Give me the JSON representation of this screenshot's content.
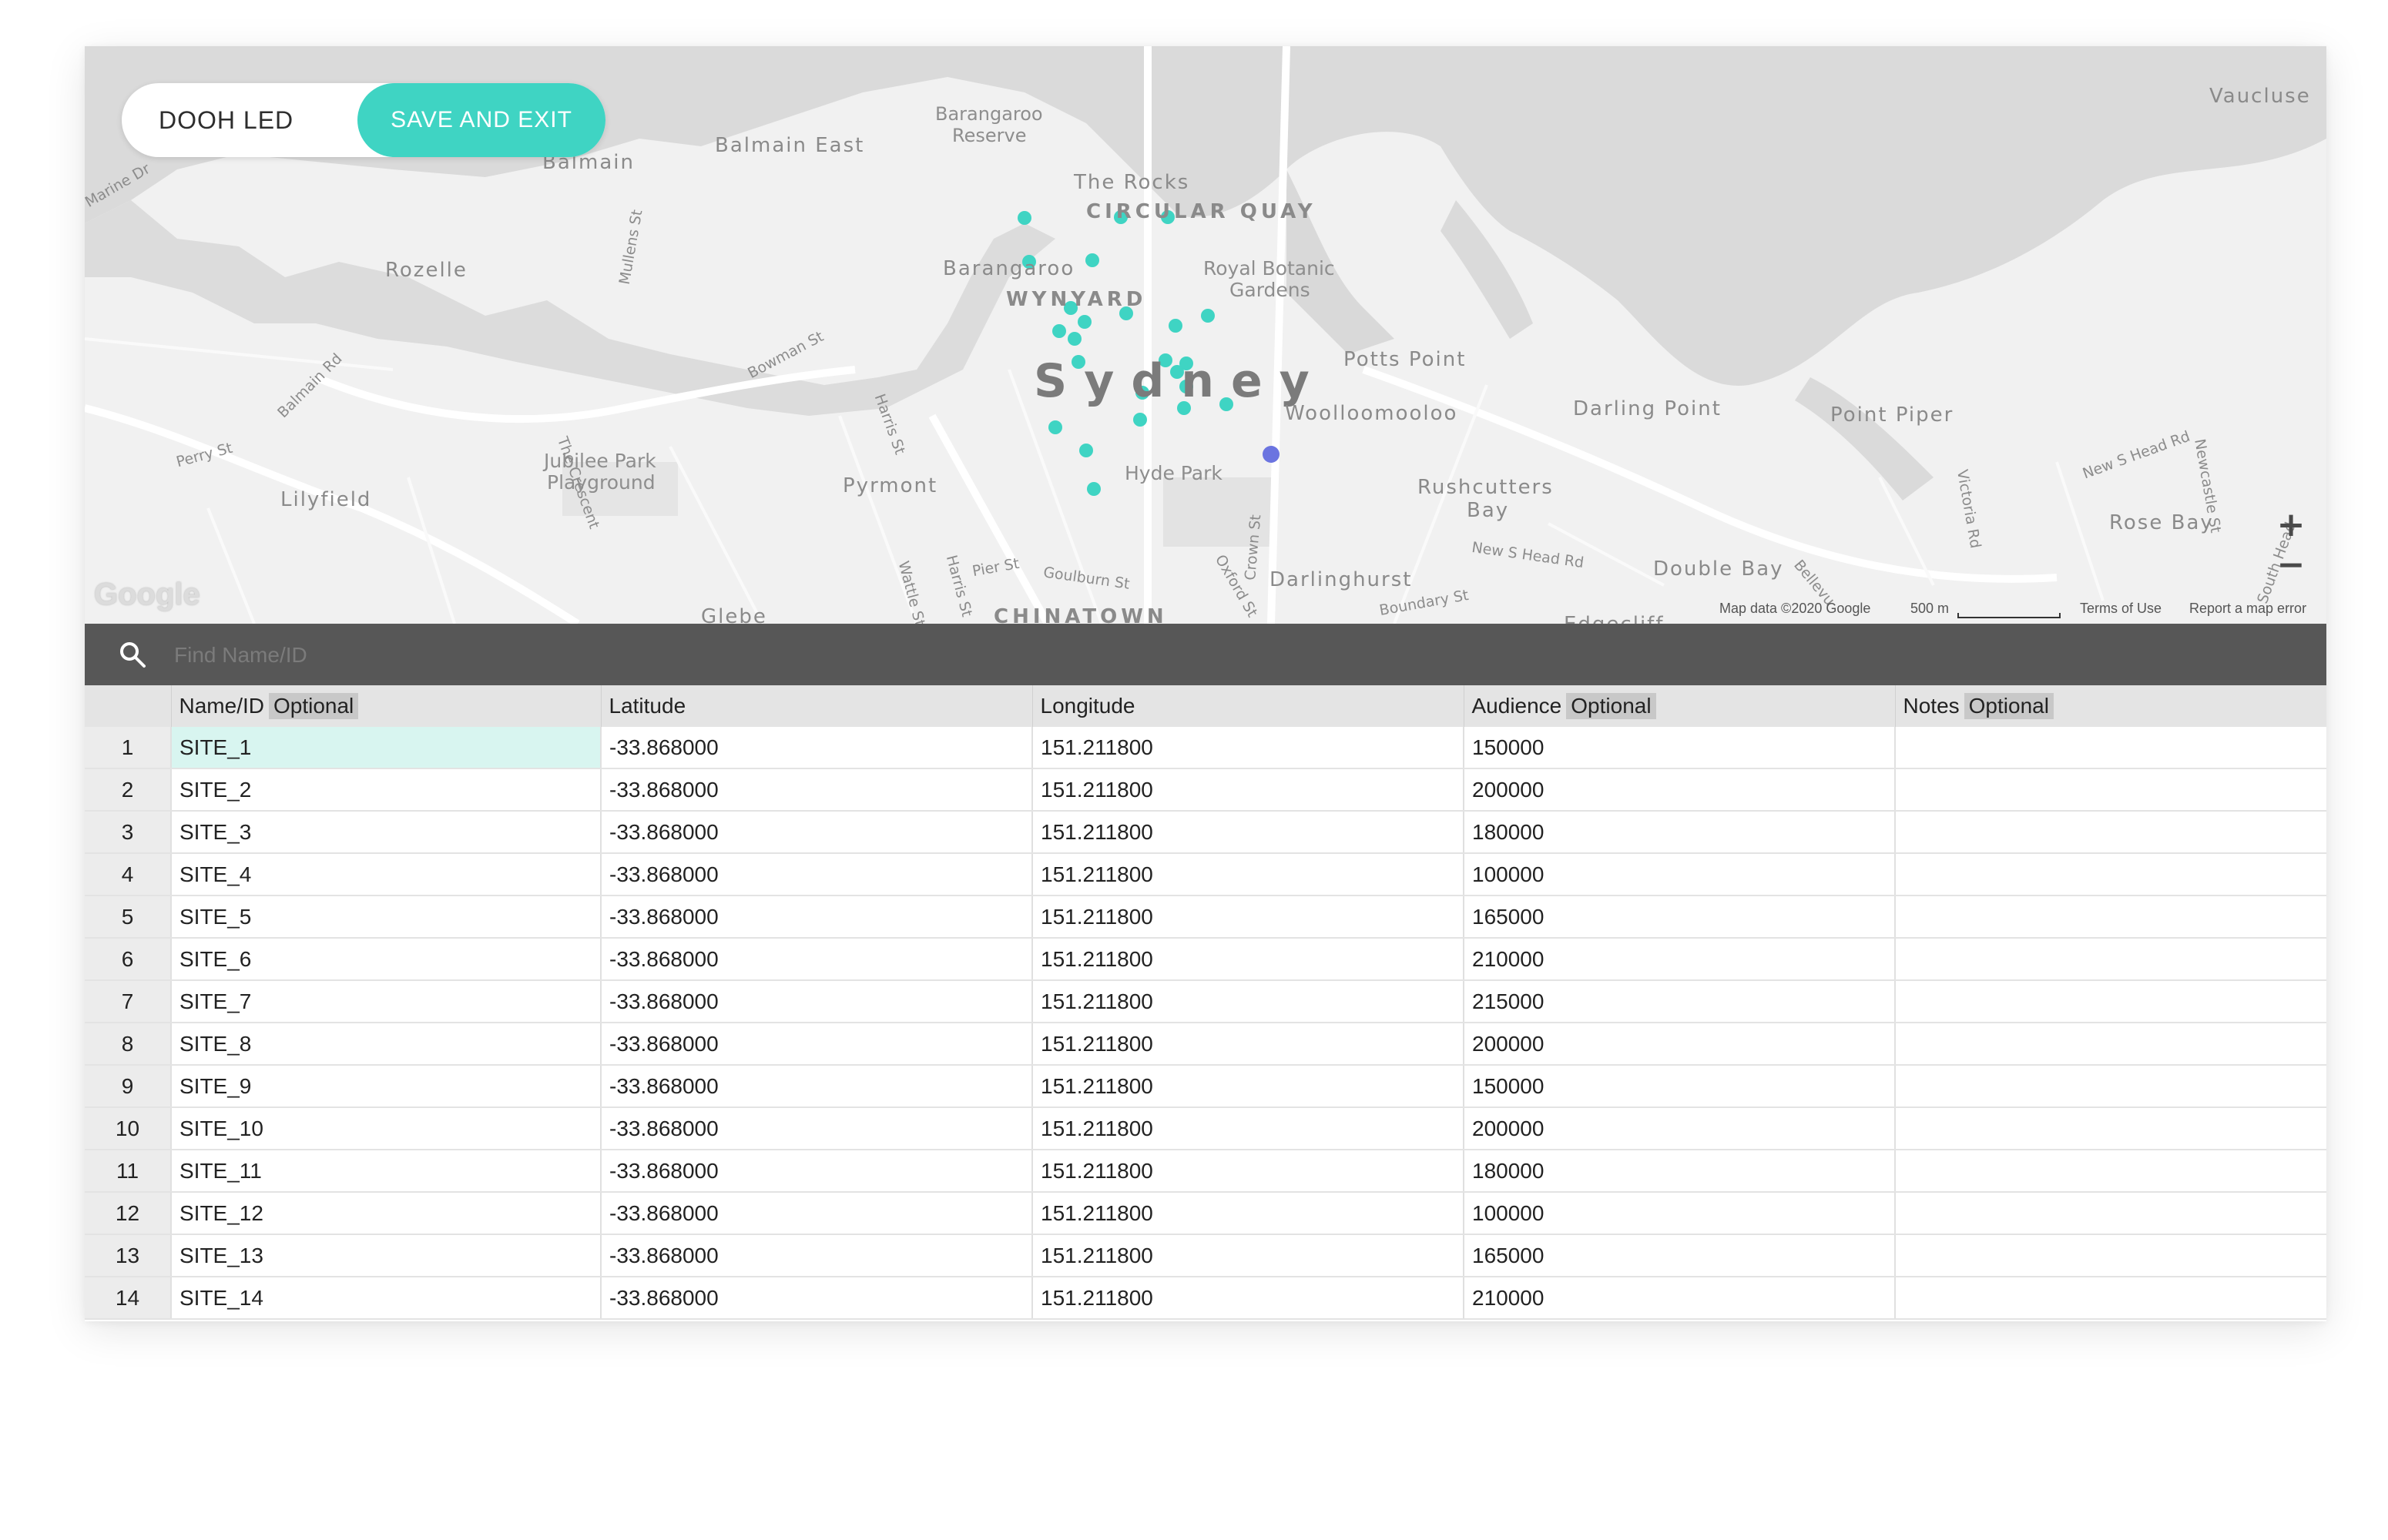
{
  "header": {
    "title": "DOOH LED",
    "save_label": "SAVE AND EXIT"
  },
  "map": {
    "city": "Sydney",
    "places": {
      "vaucluse": "Vaucluse",
      "balmain": "Balmain",
      "balmain_east": "Balmain East",
      "barangaroo_reserve_1": "Barangaroo",
      "barangaroo_reserve_2": "Reserve",
      "the_rocks": "The Rocks",
      "circular_quay": "CIRCULAR QUAY",
      "rozelle": "Rozelle",
      "barangaroo": "Barangaroo",
      "royal_botanic_1": "Royal Botanic",
      "royal_botanic_2": "Gardens",
      "wynyard": "WYNYARD",
      "potts_point": "Potts Point",
      "woolloomooloo": "Woolloomooloo",
      "darling_point": "Darling Point",
      "point_piper": "Point Piper",
      "jubilee_1": "Jubilee Park",
      "jubilee_2": "Playground",
      "lilyfield": "Lilyfield",
      "pyrmont": "Pyrmont",
      "hyde_park": "Hyde Park",
      "rushcutters_1": "Rushcutters",
      "rushcutters_2": "Bay",
      "rose_bay": "Rose Bay",
      "darlinghurst": "Darlinghurst",
      "double_bay": "Double Bay",
      "glebe": "Glebe",
      "chinatown": "CHINATOWN",
      "edgecliff": "Edgecliff"
    },
    "streets": {
      "marine_dr": "Marine Dr",
      "mullens_st": "Mullens St",
      "balmain_rd": "Balmain Rd",
      "perry_st": "Perry St",
      "the_crescent": "The Crescent",
      "bowman_st": "Bowman St",
      "harris_st": "Harris St",
      "harris_st_2": "Harris St",
      "wattle_st": "Wattle St",
      "pier_st": "Pier St",
      "goulburn_st": "Goulburn St",
      "oxford_st": "Oxford St",
      "crown_st": "Crown St",
      "boundary_st": "Boundary St",
      "new_s_head_rd": "New S Head Rd",
      "new_s_head_rd_2": "New S Head Rd",
      "victoria_rd": "Victoria Rd",
      "newcastle_st": "Newcastle St",
      "south_head": "South Head",
      "bellevue": "Bellevu"
    },
    "attribution": {
      "map_data": "Map data ©2020 Google",
      "scale": "500 m",
      "terms": "Terms of Use",
      "report": "Report a map error"
    },
    "logo": "Google",
    "marker_color": "#3fd4c3",
    "selected_marker_color": "#6b74e0",
    "zoom_in": "+",
    "zoom_out": "−"
  },
  "search": {
    "placeholder": "Find Name/ID",
    "value": ""
  },
  "table": {
    "columns": [
      {
        "label": "Name/ID",
        "badge": "Optional"
      },
      {
        "label": "Latitude",
        "badge": ""
      },
      {
        "label": "Longitude",
        "badge": ""
      },
      {
        "label": "Audience",
        "badge": "Optional"
      },
      {
        "label": "Notes",
        "badge": "Optional"
      }
    ],
    "rows": [
      {
        "idx": "1",
        "name": "SITE_1",
        "lat": "-33.868000",
        "lng": "151.211800",
        "audience": "150000",
        "notes": ""
      },
      {
        "idx": "2",
        "name": "SITE_2",
        "lat": "-33.868000",
        "lng": "151.211800",
        "audience": "200000",
        "notes": ""
      },
      {
        "idx": "3",
        "name": "SITE_3",
        "lat": "-33.868000",
        "lng": "151.211800",
        "audience": "180000",
        "notes": ""
      },
      {
        "idx": "4",
        "name": "SITE_4",
        "lat": "-33.868000",
        "lng": "151.211800",
        "audience": "100000",
        "notes": ""
      },
      {
        "idx": "5",
        "name": "SITE_5",
        "lat": "-33.868000",
        "lng": "151.211800",
        "audience": "165000",
        "notes": ""
      },
      {
        "idx": "6",
        "name": "SITE_6",
        "lat": "-33.868000",
        "lng": "151.211800",
        "audience": "210000",
        "notes": ""
      },
      {
        "idx": "7",
        "name": "SITE_7",
        "lat": "-33.868000",
        "lng": "151.211800",
        "audience": "215000",
        "notes": ""
      },
      {
        "idx": "8",
        "name": "SITE_8",
        "lat": "-33.868000",
        "lng": "151.211800",
        "audience": "200000",
        "notes": ""
      },
      {
        "idx": "9",
        "name": "SITE_9",
        "lat": "-33.868000",
        "lng": "151.211800",
        "audience": "150000",
        "notes": ""
      },
      {
        "idx": "10",
        "name": "SITE_10",
        "lat": "-33.868000",
        "lng": "151.211800",
        "audience": "200000",
        "notes": ""
      },
      {
        "idx": "11",
        "name": "SITE_11",
        "lat": "-33.868000",
        "lng": "151.211800",
        "audience": "180000",
        "notes": ""
      },
      {
        "idx": "12",
        "name": "SITE_12",
        "lat": "-33.868000",
        "lng": "151.211800",
        "audience": "100000",
        "notes": ""
      },
      {
        "idx": "13",
        "name": "SITE_13",
        "lat": "-33.868000",
        "lng": "151.211800",
        "audience": "165000",
        "notes": ""
      },
      {
        "idx": "14",
        "name": "SITE_14",
        "lat": "-33.868000",
        "lng": "151.211800",
        "audience": "210000",
        "notes": ""
      }
    ]
  }
}
